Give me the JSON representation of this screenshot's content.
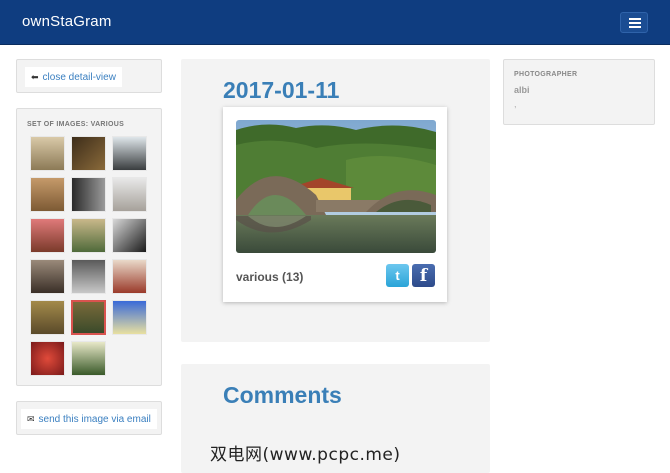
{
  "navbar": {
    "brand": "ownStaGram",
    "menu_icon": "hamburger-menu-icon"
  },
  "sidebar": {
    "close_link": {
      "icon": "arrow-left-icon",
      "label": "close detail-view"
    },
    "set_title": "SET OF IMAGES: VARIOUS",
    "thumbnails": [
      {
        "bg": "linear-gradient(#d9c9a8,#8c7a56)"
      },
      {
        "bg": "linear-gradient(135deg,#3d2d1a,#8a6a3a)"
      },
      {
        "bg": "linear-gradient(#dfe6ea,#3a3d3f)"
      },
      {
        "bg": "linear-gradient(#c59a6a,#7d5a34)"
      },
      {
        "bg": "linear-gradient(90deg,#2a2a2a,#9a9a9a)"
      },
      {
        "bg": "linear-gradient(#e8e8e8,#a6a19a)"
      },
      {
        "bg": "linear-gradient(#e07a7a,#7a3a2a)"
      },
      {
        "bg": "linear-gradient(#c9b88a,#4f6a3a)"
      },
      {
        "bg": "linear-gradient(135deg,#d8d8d8,#1a1a1a)"
      },
      {
        "bg": "linear-gradient(#9a8a7a,#3a2f27)"
      },
      {
        "bg": "linear-gradient(#5a5a5a,#c8c8c8)"
      },
      {
        "bg": "linear-gradient(#e9d9c9,#9a3a2a)"
      },
      {
        "bg": "linear-gradient(#a38a4a,#5a4a2a)"
      },
      {
        "bg": "linear-gradient(#7a6a3a,#3a4a2a)",
        "selected": true
      },
      {
        "bg": "linear-gradient(#3a6ad8,#e8e0a0)"
      },
      {
        "bg": "radial-gradient(#e04a3a,#7a1a1a)"
      },
      {
        "bg": "linear-gradient(#e8e8c8,#3a5a2a)"
      }
    ],
    "email_link": {
      "icon": "envelope-icon",
      "label": "send this image via email"
    }
  },
  "detail": {
    "date": "2017-01-11",
    "caption": "various (13)",
    "share_twitter": "t",
    "share_facebook": "f"
  },
  "comments": {
    "title": "Comments"
  },
  "photographer": {
    "label": "PHOTOGRAPHER",
    "name": "albi",
    "extra": ","
  },
  "watermark": "双电网(www.pcpc.me)"
}
